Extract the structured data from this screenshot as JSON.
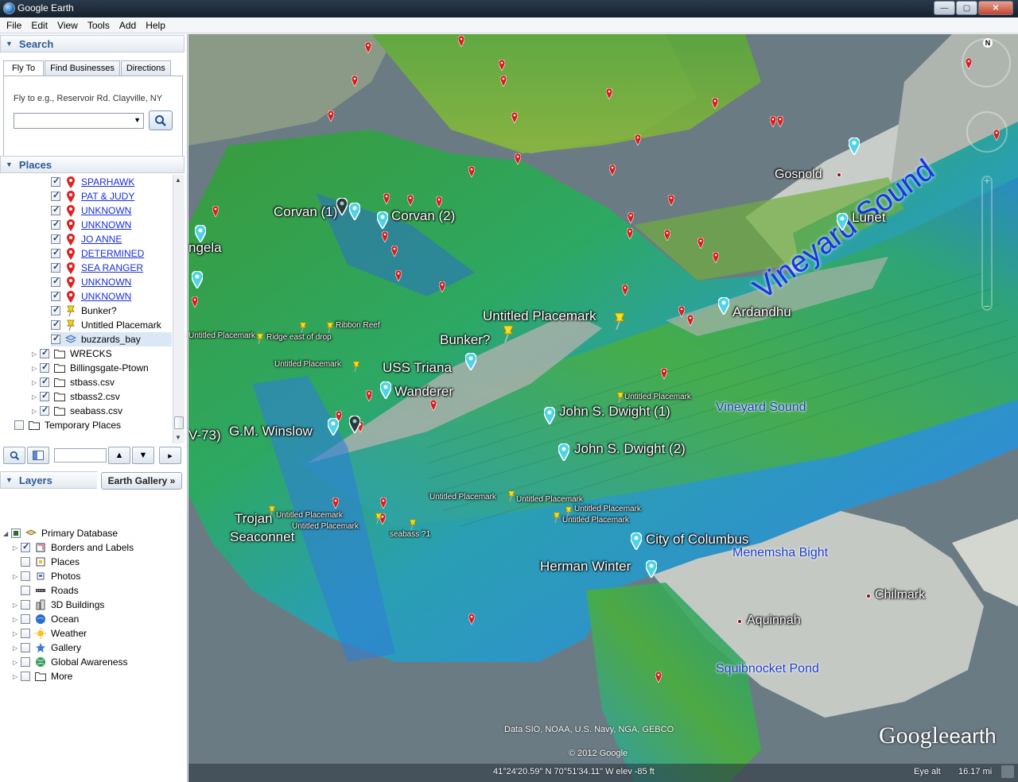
{
  "window": {
    "title": "Google Earth",
    "min": "—",
    "max": "▢",
    "close": "✕"
  },
  "menu": [
    "File",
    "Edit",
    "View",
    "Tools",
    "Add",
    "Help"
  ],
  "search": {
    "header": "Search",
    "tabs": [
      "Fly To",
      "Find Businesses",
      "Directions"
    ],
    "fly_label": "Fly to e.g., Reservoir Rd. Clayville, NY",
    "input_value": ""
  },
  "places": {
    "header": "Places",
    "items": [
      {
        "label": "SPARHAWK",
        "link": true
      },
      {
        "label": "PAT & JUDY",
        "link": true
      },
      {
        "label": "UNKNOWN",
        "link": true
      },
      {
        "label": "UNKNOWN",
        "link": true
      },
      {
        "label": "JO ANNE",
        "link": true
      },
      {
        "label": "DETERMINED",
        "link": true
      },
      {
        "label": "SEA RANGER",
        "link": true
      },
      {
        "label": "UNKNOWN",
        "link": true
      },
      {
        "label": "UNKNOWN",
        "link": true
      },
      {
        "label": "Bunker?",
        "link": false
      },
      {
        "label": "Untitled Placemark",
        "link": false
      },
      {
        "label": "buzzards_bay",
        "link": false
      }
    ],
    "folders": [
      "WRECKS",
      "Billingsgate-Ptown",
      "stbass.csv",
      "stbass2.csv",
      "seabass.csv"
    ],
    "temporary": "Temporary Places"
  },
  "layers": {
    "header": "Layers",
    "gallery_button": "Earth Gallery",
    "root": "Primary Database",
    "items": [
      {
        "label": "Borders and Labels",
        "checked": true
      },
      {
        "label": "Places",
        "checked": false
      },
      {
        "label": "Photos",
        "checked": false
      },
      {
        "label": "Roads",
        "checked": false
      },
      {
        "label": "3D Buildings",
        "checked": false
      },
      {
        "label": "Ocean",
        "checked": false
      },
      {
        "label": "Weather",
        "checked": false
      },
      {
        "label": "Gallery",
        "checked": false
      },
      {
        "label": "Global Awareness",
        "checked": false
      },
      {
        "label": "More",
        "checked": false
      }
    ]
  },
  "map": {
    "wrecks": [
      "Corvan (1)",
      "Corvan (2)",
      "ngela",
      "Lunet",
      "Ardandhu",
      "Untitled Placemark",
      "Bunker?",
      "USS Triana",
      "Wanderer",
      "John S. Dwight (1)",
      "John S. Dwight (2)",
      "G.M. Winslow",
      "V-73)",
      "Trojan",
      "Seaconnet",
      "City of Columbus",
      "Herman Winter"
    ],
    "small_labels": [
      "Untitled Placemark",
      "Ridge east of drop",
      "Ribbon Reef",
      "Untitled Placemark",
      "Untitled Placemark",
      "Untitled Placemark",
      "Untitled Placemark",
      "Untitled Placemark",
      "seabass ?1",
      "Untitled Placemark",
      "Untitled Placemark",
      "Untitled Placemark",
      "Untitled Placemark"
    ],
    "towns": [
      "Gosnold",
      "Chilmark",
      "Aquinnah"
    ],
    "water": [
      "Vineyard Sound",
      "Menemsha Bight",
      "Squibnocket Pond"
    ],
    "water_big": "Vineyard Sound",
    "compass_n": "N"
  },
  "status": {
    "data": "Data SIO, NOAA, U.S. Navy, NGA, GEBCO",
    "copyright": "© 2012 Google",
    "coords": "41°24'20.59\" N   70°51'34.11\" W  elev   -85 ft",
    "eye_label": "Eye alt",
    "eye_value": "16.17 mi",
    "logo_google": "Google",
    "logo_earth": "earth"
  }
}
